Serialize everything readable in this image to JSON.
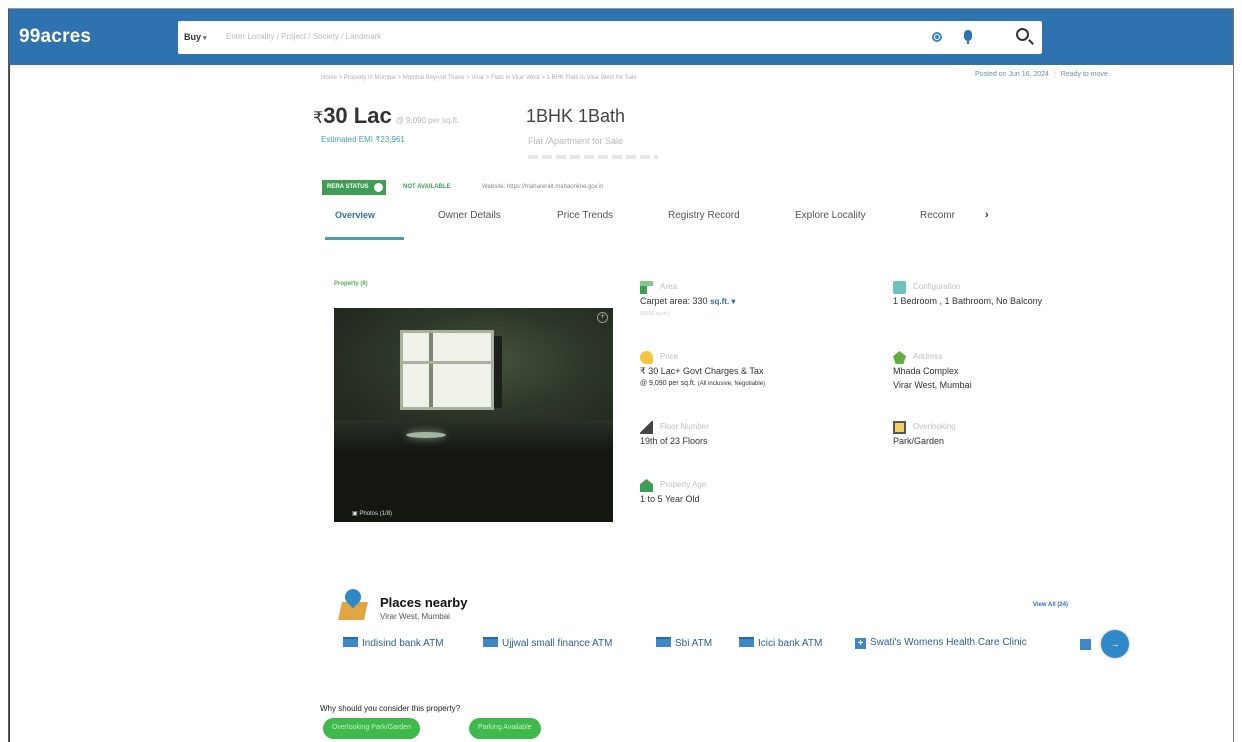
{
  "header": {
    "logo": "99acres",
    "buy_label": "Buy",
    "search_placeholder": "Enter Locality / Project / Society / Landmark"
  },
  "breadcrumb": "Home > Property in Mumbai > Mumbai Beyond Thane > Virar > Flats in Virar West > 1 BHK Flats in Virar West for Sale",
  "listing_meta": {
    "posted": "Posted on Jun 16, 2024",
    "status": "Ready to move"
  },
  "summary": {
    "price": "30 Lac",
    "price_symbol": "₹",
    "price_unit": "@ 9,090 per sq.ft.",
    "emi": "Estimated EMI ₹23,961",
    "config": "1BHK 1Bath",
    "property_type": "Flat /Apartment for Sale"
  },
  "rera": {
    "badge": "RERA STATUS",
    "status": "NOT AVAILABLE",
    "website": "Website: https://maharerait.mahaonline.gov.in"
  },
  "tabs": [
    "Overview",
    "Owner Details",
    "Price Trends",
    "Registry Record",
    "Explore Locality",
    "Recomr"
  ],
  "property": {
    "label": "Property (8)",
    "photos_count": "Photos (1/8)",
    "attributes": {
      "area": {
        "label": "Area",
        "value": "Carpet area: 330",
        "unit": "sq.ft.",
        "sub": "(30.66 sq.m.)"
      },
      "configuration": {
        "label": "Configuration",
        "value": "1 Bedroom , 1 Bathroom, No Balcony"
      },
      "price": {
        "label": "Price",
        "value": "₹ 30 Lac+ Govt Charges & Tax",
        "sub": "@ 9,090 per sq.ft.",
        "sub_small": "(All inclusive, Negotiable)"
      },
      "address": {
        "label": "Address",
        "value": "Mhada Complex",
        "sub": "Virar West, Mumbai"
      },
      "floor": {
        "label": "Floor Number",
        "value": "19th of 23 Floors"
      },
      "overlooking": {
        "label": "Overlooking",
        "value": "Park/Garden"
      },
      "age": {
        "label": "Property Age",
        "value": "1 to 5 Year Old"
      }
    }
  },
  "places_nearby": {
    "title": "Places nearby",
    "subtitle": "Virar West, Mumbai",
    "view_all": "View All (24)",
    "items": [
      "Indisind bank ATM",
      "Ujjwal small finance ATM",
      "Sbi ATM",
      "Icici bank ATM",
      "Swati's Womens Health Care Clinic"
    ]
  },
  "why": {
    "title": "Why should you consider this property?",
    "pills": [
      "Overlooking Park/Garden",
      "Parking Available"
    ]
  },
  "colors": {
    "header_blue": "#2f72b0",
    "rera_green": "#3f9d54",
    "accent_teal": "#49a1a8",
    "pill_green": "#3fb84c"
  }
}
